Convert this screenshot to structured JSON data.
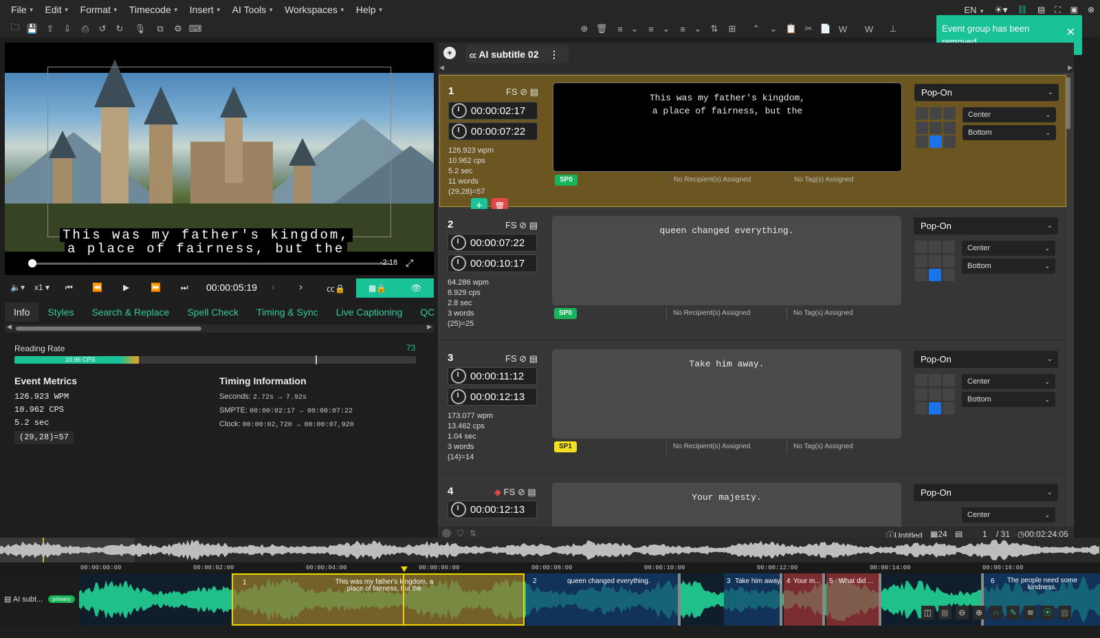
{
  "menu": {
    "items": [
      {
        "label": "File"
      },
      {
        "label": "Edit"
      },
      {
        "label": "Format"
      },
      {
        "label": "Timecode"
      },
      {
        "label": "Insert"
      },
      {
        "label": "AI Tools"
      },
      {
        "label": "Workspaces"
      },
      {
        "label": "Help"
      }
    ],
    "language": "EN"
  },
  "toast": {
    "message": "Event group has been removed."
  },
  "player": {
    "subtitle_line1": "This was my father's kingdom,",
    "subtitle_line2": "a place of fairness, but the",
    "remaining": "-2:18",
    "speed": "x1",
    "timecode": "00:00:05:19"
  },
  "tabs": [
    {
      "label": "Info"
    },
    {
      "label": "Styles"
    },
    {
      "label": "Search & Replace"
    },
    {
      "label": "Spell Check"
    },
    {
      "label": "Timing & Sync"
    },
    {
      "label": "Live Captioning"
    },
    {
      "label": "QC & R"
    }
  ],
  "info": {
    "reading_rate_label": "Reading Rate",
    "reading_rate_value": "73",
    "reading_rate_bar": "10.96 CPS",
    "reading_rate_fill": 0.31,
    "event_metrics_title": "Event Metrics",
    "metrics": [
      "126.923 WPM",
      "10.962 CPS",
      "5.2 sec",
      "(29,28)=57"
    ],
    "timing_title": "Timing Information",
    "seconds_label": "Seconds:",
    "seconds_value": "2.72s → 7.92s",
    "smpte_label": "SMPTE:",
    "smpte_value": "00:00:02:17 → 00:00:07:22",
    "clock_label": "Clock:",
    "clock_value": "00:00:02,720 → 00:00:07,920"
  },
  "track_tab": {
    "label": "AI subtitle 02"
  },
  "events": [
    {
      "num": "1",
      "fs": "FS",
      "start": "00:00:02:17",
      "end": "00:00:07:22",
      "wpm": "126.923 wpm",
      "cps": "10.962 cps",
      "dur": "5.2 sec",
      "words": "11 words",
      "chars": "(29,28)=57",
      "line1": "This was my father's kingdom,",
      "line2": "a place of fairness, but the",
      "speaker": "SP0",
      "recipients": "No Recipient(s) Assigned",
      "tags": "No Tag(s) Assigned",
      "mode": "Pop-On",
      "h_align": "Center",
      "v_align": "Bottom"
    },
    {
      "num": "2",
      "fs": "FS",
      "start": "00:00:07:22",
      "end": "00:00:10:17",
      "wpm": "64.286 wpm",
      "cps": "8.929 cps",
      "dur": "2.8 sec",
      "words": "3 words",
      "chars": "(25)=25",
      "line1": "queen changed everything.",
      "line2": "",
      "speaker": "SP0",
      "recipients": "No Recipient(s) Assigned",
      "tags": "No Tag(s) Assigned",
      "mode": "Pop-On",
      "h_align": "Center",
      "v_align": "Bottom"
    },
    {
      "num": "3",
      "fs": "FS",
      "start": "00:00:11:12",
      "end": "00:00:12:13",
      "wpm": "173.077 wpm",
      "cps": "13.462 cps",
      "dur": "1.04 sec",
      "words": "3 words",
      "chars": "(14)=14",
      "line1": "Take him away.",
      "line2": "",
      "speaker": "SP1",
      "recipients": "No Recipient(s) Assigned",
      "tags": "No Tag(s) Assigned",
      "mode": "Pop-On",
      "h_align": "Center",
      "v_align": "Bottom"
    },
    {
      "num": "4",
      "fs": "FS",
      "start": "00:00:12:13",
      "end": "",
      "line1": "Your majesty.",
      "mode": "Pop-On",
      "h_align": "Center"
    }
  ],
  "status_bar": {
    "filename": "Untitled",
    "fps": "24",
    "page": "1",
    "total": "/ 31",
    "duration": "00:02:24:05"
  },
  "timeline": {
    "ticks": [
      "00:00:00:00",
      "00:00:02:00",
      "00:00:04:00",
      "00:00:06:00",
      "00:00:08:00",
      "00:00:10:00",
      "00:00:12:00",
      "00:00:14:00",
      "00:00:16:00"
    ],
    "track_name": "AI subt...",
    "track_badge": "primary",
    "segments": [
      {
        "num": "1",
        "text": "This was my father's kingdom, a place of fairness, but the"
      },
      {
        "num": "2",
        "text": "queen changed everything."
      },
      {
        "num": "3",
        "text": "Take him away."
      },
      {
        "num": "4",
        "text": "Your m..."
      },
      {
        "num": "5",
        "text": "What did ..."
      },
      {
        "num": "6",
        "text": "The people need some kindness."
      }
    ]
  },
  "colors": {
    "accent": "#19c297",
    "active_event": "#6b5520",
    "speaker_green": "#19b45a",
    "speaker_yellow": "#f0e020"
  }
}
